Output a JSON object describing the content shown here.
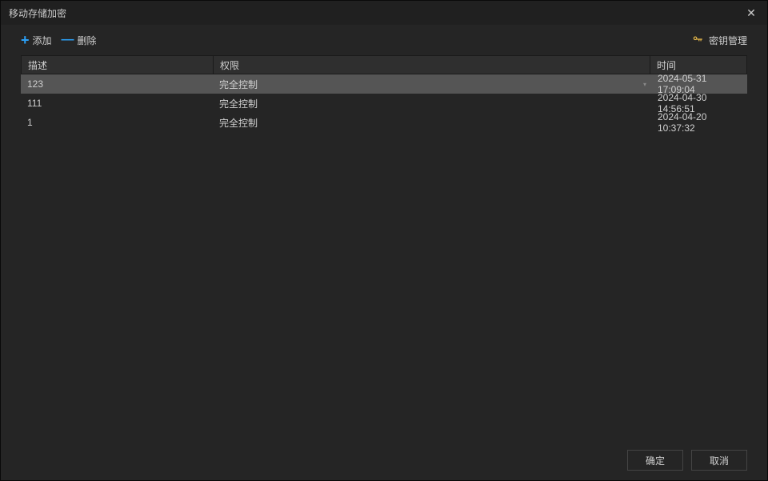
{
  "window": {
    "title": "移动存储加密"
  },
  "toolbar": {
    "add_label": "添加",
    "delete_label": "删除",
    "key_manage_label": "密钥管理"
  },
  "table": {
    "headers": {
      "description": "描述",
      "permission": "权限",
      "time": "时间"
    },
    "rows": [
      {
        "description": "123",
        "permission": "完全控制",
        "time": "2024-05-31 17:09:04",
        "selected": true
      },
      {
        "description": "111",
        "permission": "完全控制",
        "time": "2024-04-30 14:56:51",
        "selected": false
      },
      {
        "description": "1",
        "permission": "完全控制",
        "time": "2024-04-20 10:37:32",
        "selected": false
      }
    ]
  },
  "footer": {
    "confirm_label": "确定",
    "cancel_label": "取消"
  }
}
